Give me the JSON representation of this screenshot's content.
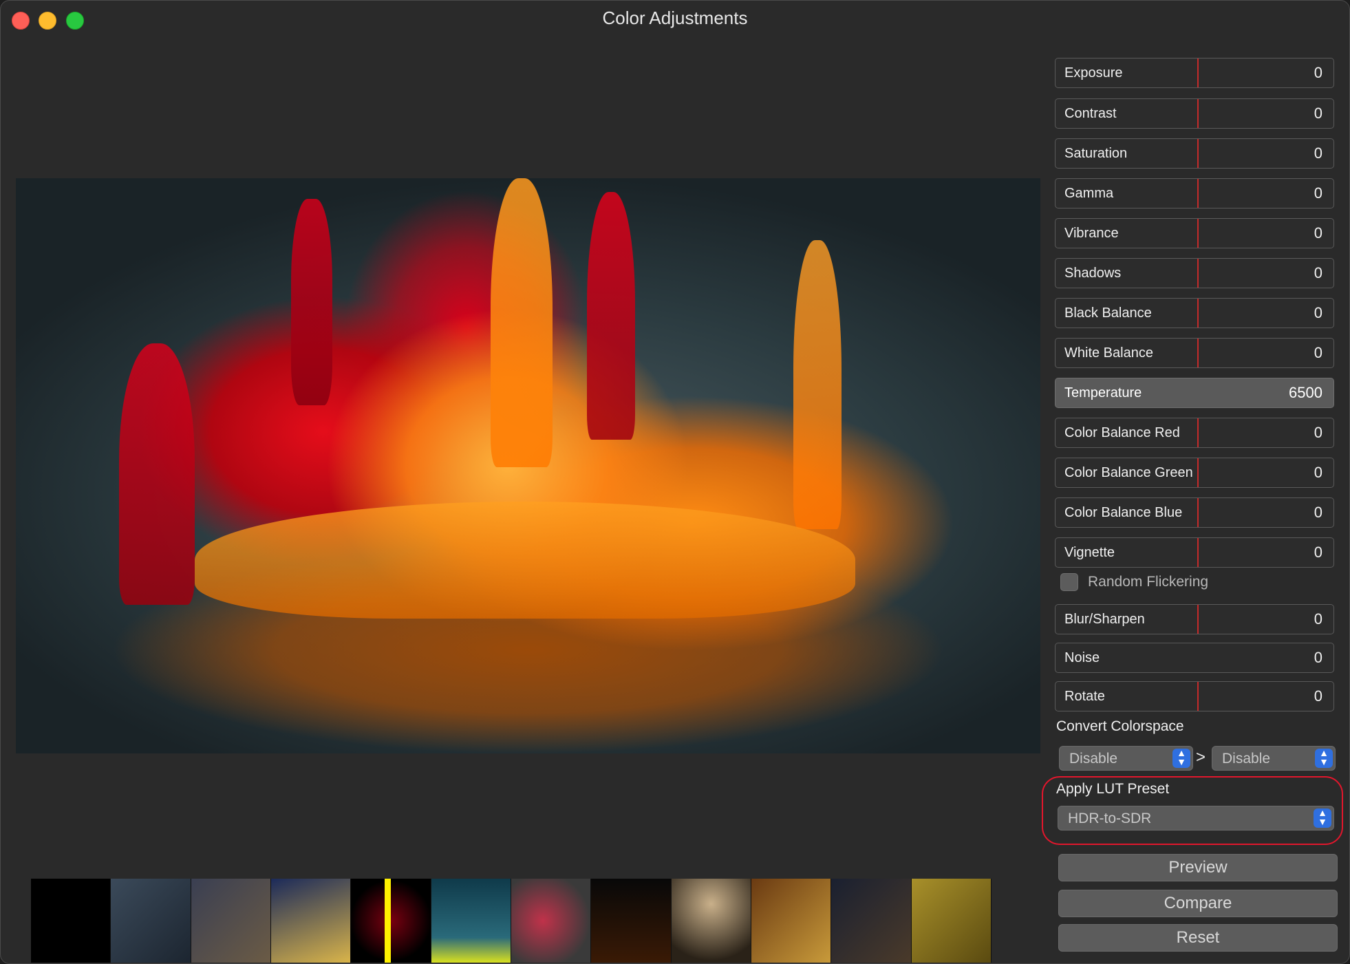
{
  "window": {
    "title": "Color Adjustments"
  },
  "adjustments": [
    {
      "label": "Exposure",
      "value": "0"
    },
    {
      "label": "Contrast",
      "value": "0"
    },
    {
      "label": "Saturation",
      "value": "0"
    },
    {
      "label": "Gamma",
      "value": "0"
    },
    {
      "label": "Vibrance",
      "value": "0"
    },
    {
      "label": "Shadows",
      "value": "0"
    },
    {
      "label": "Black Balance",
      "value": "0"
    },
    {
      "label": "White Balance",
      "value": "0"
    },
    {
      "label": "Temperature",
      "value": "6500"
    },
    {
      "label": "Color Balance Red",
      "value": "0"
    },
    {
      "label": "Color Balance Green",
      "value": "0"
    },
    {
      "label": "Color Balance Blue",
      "value": "0"
    },
    {
      "label": "Vignette",
      "value": "0"
    }
  ],
  "random_flickering": {
    "label": "Random Flickering",
    "checked": false
  },
  "adjustments2": [
    {
      "label": "Blur/Sharpen",
      "value": "0"
    },
    {
      "label": "Noise",
      "value": "0"
    },
    {
      "label": "Rotate",
      "value": "0"
    }
  ],
  "colorspace": {
    "label": "Convert Colorspace",
    "from": "Disable",
    "separator": ">",
    "to": "Disable"
  },
  "lut": {
    "label": "Apply LUT Preset",
    "value": "HDR-to-SDR"
  },
  "buttons": {
    "preview": "Preview",
    "compare": "Compare",
    "reset": "Reset"
  },
  "colors": {
    "accent": "#2f6fe0",
    "marker": "#c52a2a",
    "highlight": "#e2162c"
  }
}
